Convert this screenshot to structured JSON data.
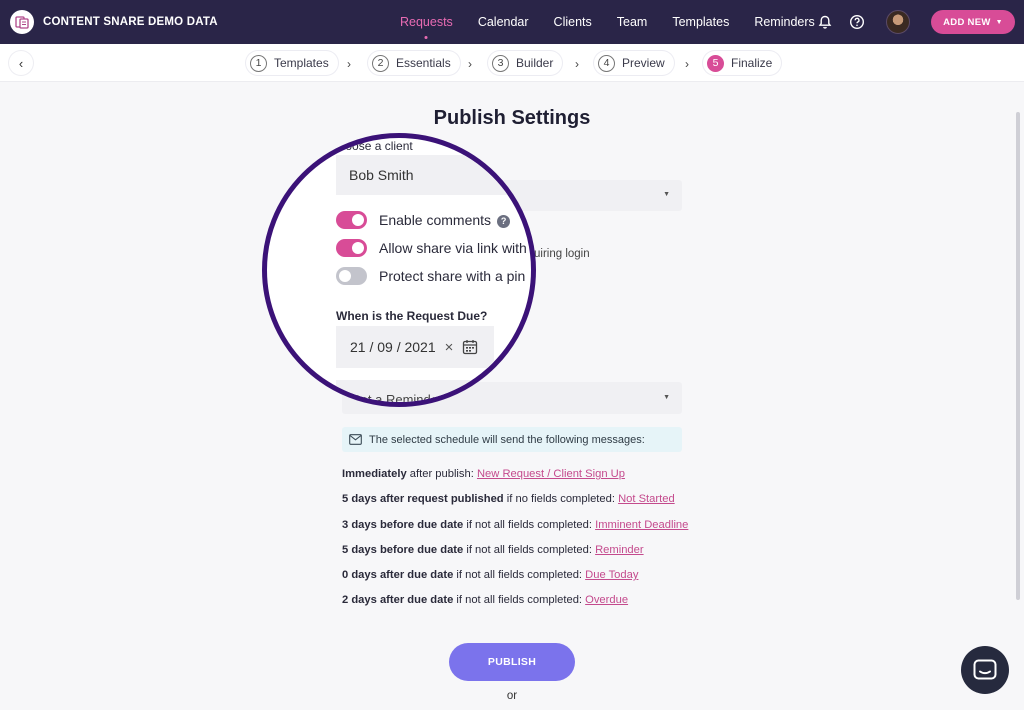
{
  "brand": {
    "name": "CONTENT SNARE DEMO DATA",
    "logo_icon": "content-snare-logo-icon"
  },
  "nav": {
    "links": [
      "Requests",
      "Calendar",
      "Clients",
      "Team",
      "Templates",
      "Reminders"
    ],
    "active": "Requests",
    "icons": [
      "bell-icon",
      "help-circle-icon"
    ],
    "add_new": "ADD NEW"
  },
  "steps": [
    {
      "num": "1",
      "label": "Templates"
    },
    {
      "num": "2",
      "label": "Essentials"
    },
    {
      "num": "3",
      "label": "Builder"
    },
    {
      "num": "4",
      "label": "Preview"
    },
    {
      "num": "5",
      "label": "Finalize"
    }
  ],
  "current_step": "5",
  "page": {
    "title": "Publish Settings"
  },
  "form": {
    "client_label": "Choose a client",
    "client_value": "Bob Smith",
    "toggles": [
      {
        "label": "Enable comments",
        "on": true
      },
      {
        "label": "Allow share via link with",
        "on": true
      },
      {
        "label": "Protect share with a pin",
        "on": false
      }
    ],
    "toggle_2_suffix": "uiring login",
    "due_label": "When is the Request Due?",
    "due_date": "21 / 09 / 2021",
    "reminder_placeholder": "Set a Reminder",
    "info_text": "The selected schedule will send the following messages:"
  },
  "schedule": [
    {
      "bold": "Immediately",
      "text": " after publish: ",
      "link": "New Request / Client Sign Up"
    },
    {
      "bold": "5 days after request published",
      "text": " if no fields completed: ",
      "link": "Not Started"
    },
    {
      "bold": "3 days before due date",
      "text": " if not all fields completed: ",
      "link": "Imminent Deadline"
    },
    {
      "bold": "5 days before due date",
      "text": " if not all fields completed: ",
      "link": "Reminder"
    },
    {
      "bold": "0 days after due date",
      "text": " if not all fields completed: ",
      "link": "Due Today"
    },
    {
      "bold": "2 days after due date",
      "text": " if not all fields completed: ",
      "link": "Overdue"
    }
  ],
  "actions": {
    "publish": "PUBLISH",
    "or": "or"
  },
  "colors": {
    "nav_bg": "#2a2548",
    "accent_pink": "#d84c97",
    "publish_purple": "#7b73ec",
    "lens_border": "#3b1278",
    "info_bg": "#e6f4f8"
  }
}
